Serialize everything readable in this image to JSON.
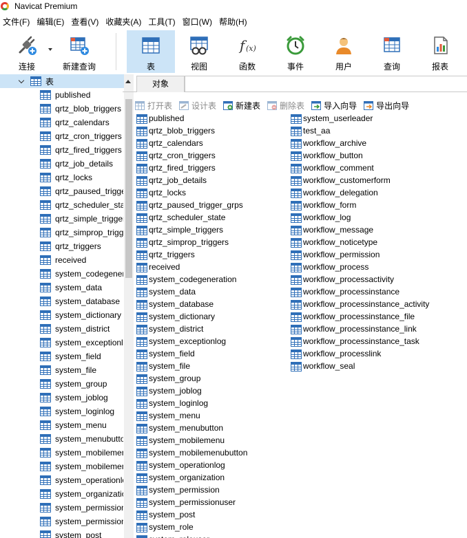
{
  "window": {
    "title": "Navicat Premium"
  },
  "menu": [
    "文件(F)",
    "编辑(E)",
    "查看(V)",
    "收藏夹(A)",
    "工具(T)",
    "窗口(W)",
    "帮助(H)"
  ],
  "toolbar": {
    "connect": "连接",
    "new_query": "新建查询",
    "table": "表",
    "view": "视图",
    "function": "函数",
    "event": "事件",
    "user": "用户",
    "query": "查询",
    "report": "报表"
  },
  "tree": {
    "root_label": "表",
    "items": [
      "published",
      "qrtz_blob_triggers",
      "qrtz_calendars",
      "qrtz_cron_triggers",
      "qrtz_fired_triggers",
      "qrtz_job_details",
      "qrtz_locks",
      "qrtz_paused_trigger_grps",
      "qrtz_scheduler_state",
      "qrtz_simple_triggers",
      "qrtz_simprop_triggers",
      "qrtz_triggers",
      "received",
      "system_codegeneration",
      "system_data",
      "system_database",
      "system_dictionary",
      "system_district",
      "system_exceptionlog",
      "system_field",
      "system_file",
      "system_group",
      "system_joblog",
      "system_loginlog",
      "system_menu",
      "system_menubutton",
      "system_mobilemenu",
      "system_mobilemenubutton",
      "system_operationlog",
      "system_organization",
      "system_permission",
      "system_permissionuser",
      "system_post"
    ]
  },
  "tabs": {
    "objects": "对象"
  },
  "object_toolbar": {
    "open": "打开表",
    "design": "设计表",
    "new": "新建表",
    "delete": "删除表",
    "import": "导入向导",
    "export": "导出向导"
  },
  "objects": {
    "col1": [
      "published",
      "qrtz_blob_triggers",
      "qrtz_calendars",
      "qrtz_cron_triggers",
      "qrtz_fired_triggers",
      "qrtz_job_details",
      "qrtz_locks",
      "qrtz_paused_trigger_grps",
      "qrtz_scheduler_state",
      "qrtz_simple_triggers",
      "qrtz_simprop_triggers",
      "qrtz_triggers",
      "received",
      "system_codegeneration",
      "system_data",
      "system_database",
      "system_dictionary",
      "system_district",
      "system_exceptionlog",
      "system_field",
      "system_file",
      "system_group",
      "system_joblog",
      "system_loginlog",
      "system_menu",
      "system_menubutton",
      "system_mobilemenu",
      "system_mobilemenubutton",
      "system_operationlog",
      "system_organization",
      "system_permission",
      "system_permissionuser",
      "system_post",
      "system_role",
      "system_roleuser"
    ],
    "col2": [
      "system_userleader",
      "test_aa",
      "workflow_archive",
      "workflow_button",
      "workflow_comment",
      "workflow_customerform",
      "workflow_delegation",
      "workflow_form",
      "workflow_log",
      "workflow_message",
      "workflow_noticetype",
      "workflow_permission",
      "workflow_process",
      "workflow_processactivity",
      "workflow_processinstance",
      "workflow_processinstance_activity",
      "workflow_processinstance_file",
      "workflow_processinstance_link",
      "workflow_processinstance_task",
      "workflow_processlink",
      "workflow_seal"
    ]
  }
}
